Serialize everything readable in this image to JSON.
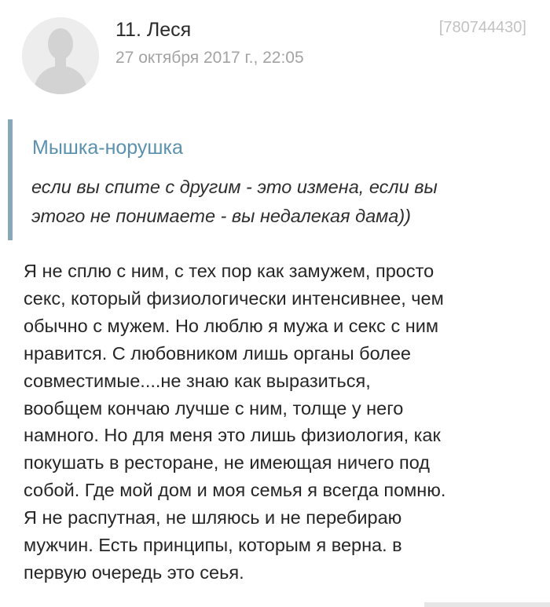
{
  "comment": {
    "author": "11. Леся",
    "date": "27 октября 2017 г., 22:05",
    "id": "[780744430]",
    "avatar_icon": "default-user-silhouette-icon",
    "quote": {
      "author": "Мышка-норушка",
      "text_lines": [
        "если вы спите с другим - это измена, если вы",
        "этого не понимаете - вы недалекая дама))"
      ]
    },
    "body_lines": [
      "Я не сплю с ним, с тех пор как замужем, просто",
      "секс, который физиологически интенсивнее, чем",
      "обычно с мужем. Но люблю я мужа и секс с ним",
      "нравится. С любовником лишь органы более",
      "совместимые....не знаю как выразиться,",
      "вообщем кончаю лучше с ним, толще у него",
      "намного. Но для меня это лишь физиология, как",
      "покушать в ресторане, не имеющая ничего под",
      "собой. Где мой дом и моя семья я всегда помню.",
      "Я не распутная, не шляюсь и не перебираю",
      "мужчин. Есть принципы, которым я верна. в",
      "первую очередь это сеья."
    ]
  },
  "colors": {
    "quote_bar": "#8aa7bb",
    "quote_author": "#5a91ae",
    "date": "#a3a3a3",
    "id": "#c2c2c2"
  }
}
